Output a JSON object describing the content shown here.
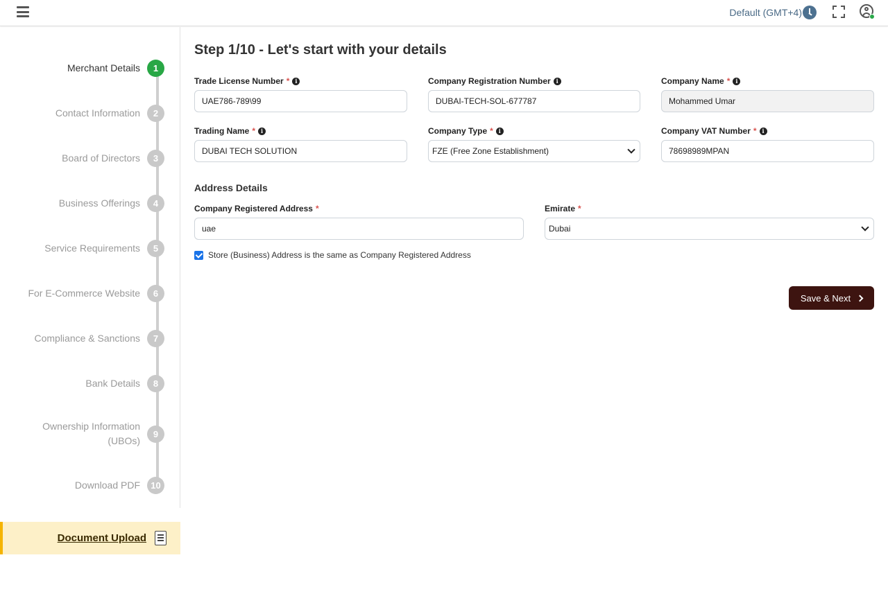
{
  "header": {
    "timezone_label": "Default (GMT+4)",
    "icons": [
      "menu-icon",
      "clock-icon",
      "fullscreen-icon",
      "user-icon"
    ]
  },
  "sidebar": {
    "steps": [
      {
        "label": "Merchant Details",
        "num": "1",
        "active": true
      },
      {
        "label": "Contact Information",
        "num": "2"
      },
      {
        "label": "Board of Directors",
        "num": "3"
      },
      {
        "label": "Business Offerings",
        "num": "4"
      },
      {
        "label": "Service Requirements",
        "num": "5"
      },
      {
        "label": "For E-Commerce Website",
        "num": "6"
      },
      {
        "label": "Compliance & Sanctions",
        "num": "7"
      },
      {
        "label": "Bank Details",
        "num": "8"
      },
      {
        "label_line1": "Ownership Information",
        "label_line2": "(UBOs)",
        "num": "9"
      },
      {
        "label": "Download PDF",
        "num": "10"
      }
    ],
    "document_upload": "Document Upload"
  },
  "form": {
    "title": "Step 1/10 - Let's start with your details",
    "trade_license": {
      "label": "Trade License Number",
      "value": "UAE786-789\\99"
    },
    "company_reg": {
      "label": "Company Registration Number",
      "value": "DUBAI-TECH-SOL-677787"
    },
    "company_name": {
      "label": "Company Name",
      "value": "Mohammed Umar"
    },
    "trading_name": {
      "label": "Trading Name",
      "value": "DUBAI TECH SOLUTION"
    },
    "company_type": {
      "label": "Company Type",
      "value": "FZE (Free Zone Establishment)"
    },
    "company_vat": {
      "label": "Company VAT Number",
      "value": "78698989MPAN"
    },
    "address_section": "Address Details",
    "registered_address": {
      "label": "Company Registered Address",
      "value": "uae"
    },
    "emirate": {
      "label": "Emirate",
      "value": "Dubai"
    },
    "same_address_checkbox": "Store (Business) Address is the same as Company Registered Address",
    "save_button": "Save & Next",
    "required_mark": "*",
    "info_mark": "i"
  },
  "colors": {
    "accent_green": "#28a745",
    "button": "#3d1410",
    "highlight": "#fdf0c8",
    "timezone": "#4a6a86"
  }
}
